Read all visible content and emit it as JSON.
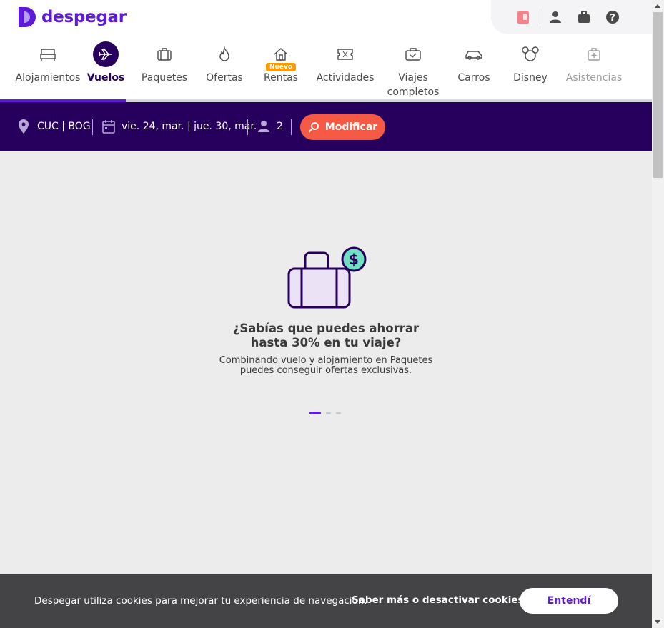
{
  "brand": {
    "name": "despegar",
    "color": "#5d1ad8"
  },
  "utility": {
    "icons": [
      "promo-ticket-icon",
      "user-icon",
      "suitcase-icon",
      "help-icon"
    ]
  },
  "nav": {
    "items": [
      {
        "label": "Alojamientos",
        "icon": "bed-icon",
        "active": false
      },
      {
        "label": "Vuelos",
        "icon": "plane-icon",
        "active": true
      },
      {
        "label": "Paquetes",
        "icon": "luggage-icon",
        "active": false
      },
      {
        "label": "Ofertas",
        "icon": "flame-icon",
        "active": false
      },
      {
        "label": "Rentas",
        "icon": "house-icon",
        "active": false,
        "badge": "Nuevo"
      },
      {
        "label": "Actividades",
        "icon": "ticket-icon",
        "active": false
      },
      {
        "label": "Viajes completos",
        "label_line1": "Viajes",
        "label_line2": "completos",
        "icon": "briefcase-check-icon",
        "active": false
      },
      {
        "label": "Carros",
        "icon": "car-icon",
        "active": false
      },
      {
        "label": "Disney",
        "icon": "mickey-icon",
        "active": false
      },
      {
        "label": "Asistencias",
        "icon": "medkit-icon",
        "active": false
      }
    ]
  },
  "search": {
    "route": "CUC | BOG",
    "route_from": "CUC",
    "route_to": "BOG",
    "date_out": "vie. 24, mar.",
    "date_return": "jue. 30, mar.",
    "passengers": "2",
    "modify_label": "Modificar",
    "colors": {
      "bar": "#27005e",
      "button": "#f65a45"
    }
  },
  "promo": {
    "title_line1": "¿Sabías que puedes ahorrar",
    "title_line2": "hasta 30% en tu viaje?",
    "text_line1": "Combinando vuelo y alojamiento en Paquetes",
    "text_line2": "puedes conseguir ofertas exclusivas.",
    "slides": 3,
    "active_slide": 1
  },
  "cookie": {
    "text": "Despegar utiliza cookies para mejorar tu experiencia de navegación.",
    "link": "Saber más o desactivar cookies.",
    "button": "Entendí"
  }
}
